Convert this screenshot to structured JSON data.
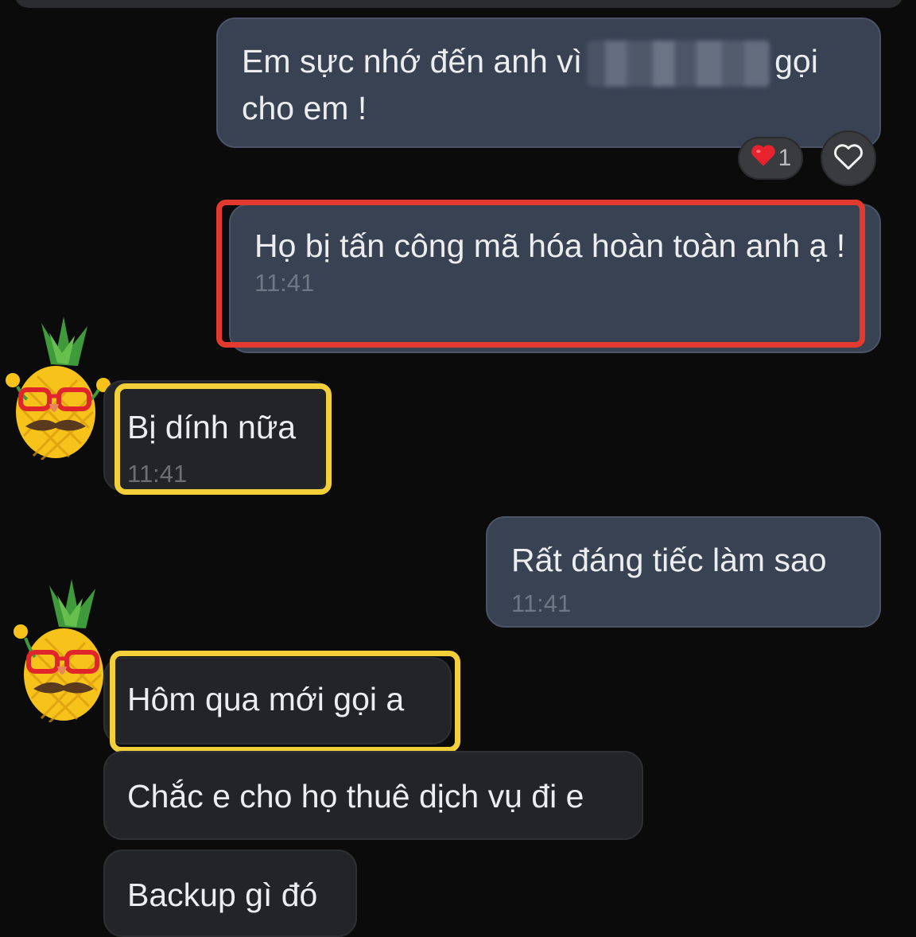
{
  "messages": [
    {
      "id": "m1",
      "direction": "outgoing",
      "text_before": "Em sực nhớ đến anh vì",
      "text_redacted": true,
      "text_after": "gọi cho em !",
      "reaction": {
        "emoji": "heart",
        "count": "1"
      }
    },
    {
      "id": "m2",
      "direction": "outgoing",
      "text": "Họ bị tấn công mã hóa hoàn toàn anh ạ !",
      "time": "11:41",
      "highlight": "#e23a2e"
    },
    {
      "id": "m3",
      "direction": "incoming",
      "text": "Bị dính nữa",
      "time": "11:41",
      "highlight": "#f3cf3a"
    },
    {
      "id": "m4",
      "direction": "outgoing",
      "text": "Rất đáng tiếc làm sao",
      "time": "11:41"
    },
    {
      "id": "m5",
      "direction": "incoming",
      "text": "Hôm qua mới gọi a",
      "highlight": "#f3cf3a"
    },
    {
      "id": "m6",
      "direction": "incoming",
      "text": "Chắc e cho họ thuê dịch vụ đi e"
    },
    {
      "id": "m7",
      "direction": "incoming",
      "text": "Backup gì đó"
    }
  ],
  "colors": {
    "background": "#0b0b0c",
    "outgoing_bubble": "#384253",
    "incoming_bubble": "#232427",
    "red_highlight": "#e23a2e",
    "yellow_highlight": "#f3cf3a"
  },
  "icons": {
    "avatar": "pineapple-avatar-icon",
    "reaction": "heart-icon",
    "like": "heart-outline-icon"
  }
}
